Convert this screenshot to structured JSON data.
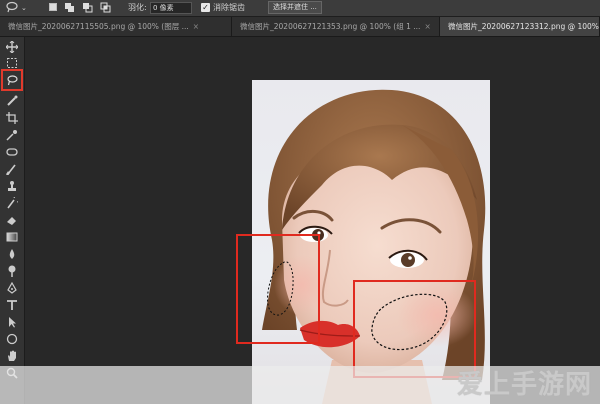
{
  "options_bar": {
    "feather_label": "羽化:",
    "feather_value": "0 像素",
    "antialias_label": "消除锯齿",
    "select_mask_label": "选择并遮住 ..."
  },
  "tabs": [
    {
      "label": "微信图片_20200627115505.png @ 100% (图层 ...",
      "active": false
    },
    {
      "label": "微信图片_20200627121353.png @ 100% (组 1 ...",
      "active": false
    },
    {
      "label": "微信图片_20200627123312.png @ 100%",
      "active": true
    }
  ],
  "tools": [
    "move-icon",
    "marquee-icon",
    "lasso-icon",
    "brush-quick-select-icon",
    "crop-icon",
    "eyedropper-icon",
    "patch-icon",
    "brush-icon",
    "stamp-icon",
    "history-brush-icon",
    "eraser-icon",
    "gradient-icon",
    "blur-icon",
    "dodge-icon",
    "pen-icon",
    "type-icon",
    "path-select-icon",
    "ellipse-icon",
    "hand-icon",
    "zoom-icon"
  ],
  "selected_tool": "lasso-icon",
  "accent_color": "#e02a1f",
  "watermark": "爱上手游网"
}
